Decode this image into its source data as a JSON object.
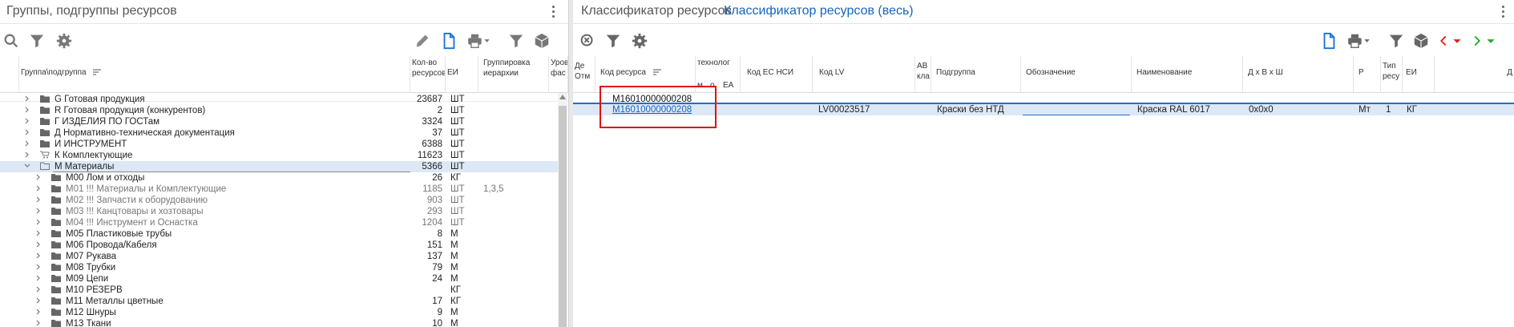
{
  "left": {
    "title": "Группы, подгруппы ресурсов",
    "columns": {
      "group": "Группа\\подгруппа",
      "count": "Кол-во ресурсов",
      "unit": "ЕИ",
      "grouping": "Группировка иерархии",
      "level": "Уровень фас"
    },
    "rows": [
      {
        "name": "G Готовая продукция",
        "count": "23687",
        "unit": "ШТ",
        "grouping": ""
      },
      {
        "name": "R Готовая продукция (конкурентов)",
        "count": "2",
        "unit": "ШТ",
        "grouping": ""
      },
      {
        "name": "Г ИЗДЕЛИЯ ПО ГОСТам",
        "count": "3324",
        "unit": "ШТ",
        "grouping": ""
      },
      {
        "name": "Д Нормативно-техническая документация",
        "count": "37",
        "unit": "ШТ",
        "grouping": ""
      },
      {
        "name": "И ИНСТРУМЕНТ",
        "count": "6388",
        "unit": "ШТ",
        "grouping": ""
      },
      {
        "name": "К Комплектующие",
        "count": "11623",
        "unit": "ШТ",
        "grouping": ""
      },
      {
        "name": "М Материалы",
        "count": "5366",
        "unit": "ШТ",
        "grouping": ""
      },
      {
        "name": "М00 Лом и отходы",
        "count": "26",
        "unit": "КГ",
        "grouping": ""
      },
      {
        "name": "М01 !!!   Материалы и Комплектующие",
        "count": "1185",
        "unit": "ШТ",
        "grouping": "1,3,5"
      },
      {
        "name": "М02 !!!   Запчасти к оборудованию",
        "count": "903",
        "unit": "ШТ",
        "grouping": ""
      },
      {
        "name": "М03 !!!   Канцтовары и хозтовары",
        "count": "293",
        "unit": "ШТ",
        "grouping": ""
      },
      {
        "name": "М04 !!!   Инструмент и Оснастка",
        "count": "1204",
        "unit": "ШТ",
        "grouping": ""
      },
      {
        "name": "М05 Пластиковые трубы",
        "count": "8",
        "unit": "М",
        "grouping": ""
      },
      {
        "name": "М06 Провода/Кабеля",
        "count": "151",
        "unit": "М",
        "grouping": ""
      },
      {
        "name": "М07 Рукава",
        "count": "137",
        "unit": "М",
        "grouping": ""
      },
      {
        "name": "М08 Трубки",
        "count": "79",
        "unit": "М",
        "grouping": ""
      },
      {
        "name": "М09 Цепи",
        "count": "24",
        "unit": "М",
        "grouping": ""
      },
      {
        "name": "М10 РЕЗЕРВ",
        "count": "",
        "unit": "КГ",
        "grouping": ""
      },
      {
        "name": "М11 Металлы цветные",
        "count": "17",
        "unit": "КГ",
        "grouping": ""
      },
      {
        "name": "М12 Шнуры",
        "count": "9",
        "unit": "М",
        "grouping": ""
      },
      {
        "name": "М13 Ткани",
        "count": "10",
        "unit": "М",
        "grouping": ""
      }
    ]
  },
  "right": {
    "tab1": "Классификатор ресурсов",
    "tab2": "Классификатор ресурсов (весь)",
    "columns": {
      "de": "Де Отм",
      "code": "Код ресурса",
      "tech": "технолог",
      "tech_m": "м",
      "tech_o": "о",
      "tech_ea": "ЕА",
      "ec_code": "Код ЕС НСИ",
      "lv_code": "Код LV",
      "av": "АВ кла",
      "subgroup": "Подгруппа",
      "designation": "Обозначение",
      "name": "Наименование",
      "dims": "Д х В х Ш",
      "r": "Р",
      "type": "Тип ресу",
      "unit": "ЕИ",
      "last": "Д"
    },
    "filter_code": "M16010000000208",
    "record": {
      "code": "M16010000000208",
      "lv_code": "LV00023517",
      "subgroup": "Краски без НТД",
      "designation": "",
      "name": "Краска RAL 6017",
      "dims": "0х0х0",
      "r": "Мт",
      "type": "1",
      "unit": "КГ"
    }
  }
}
